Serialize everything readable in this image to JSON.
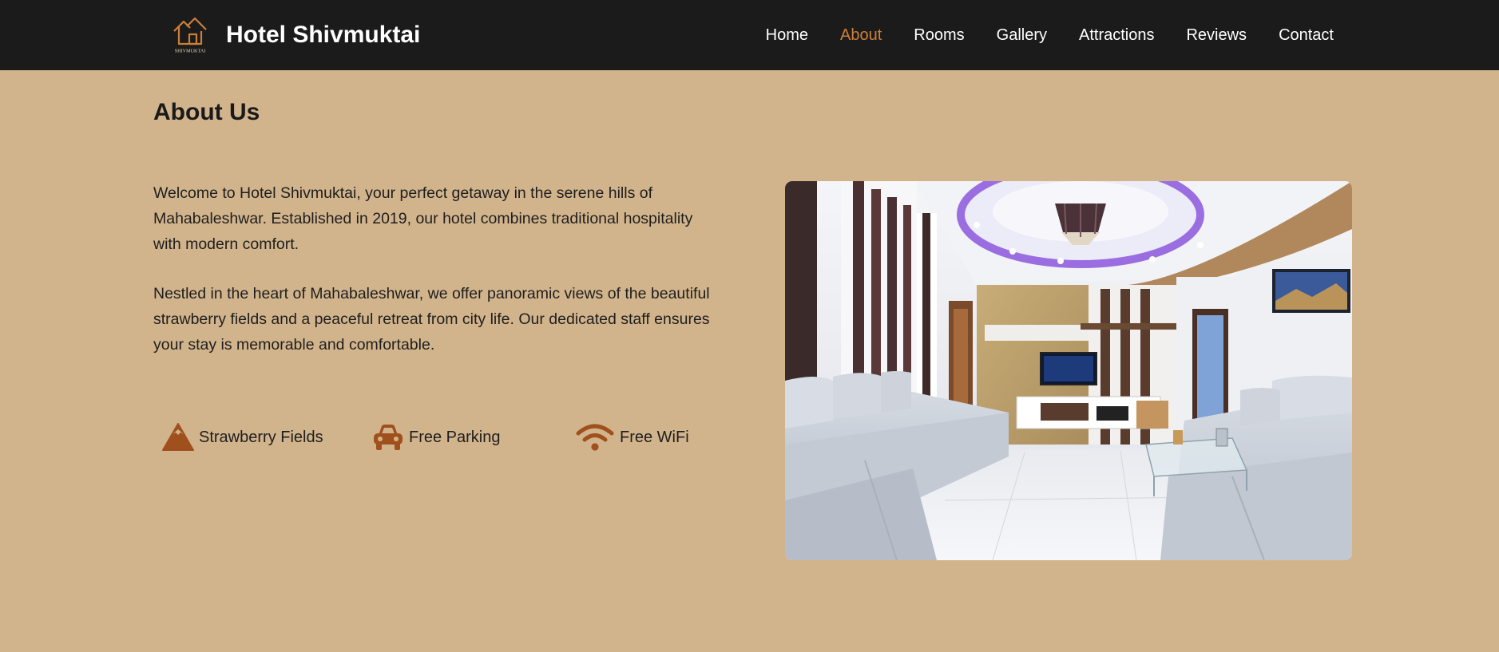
{
  "brand": {
    "name": "Hotel Shivmuktai",
    "logo_text": "SHIVMUKTAI",
    "logo_icon": "house-logo-icon"
  },
  "nav": {
    "items": [
      {
        "label": "Home",
        "active": false
      },
      {
        "label": "About",
        "active": true
      },
      {
        "label": "Rooms",
        "active": false
      },
      {
        "label": "Gallery",
        "active": false
      },
      {
        "label": "Attractions",
        "active": false
      },
      {
        "label": "Reviews",
        "active": false
      },
      {
        "label": "Contact",
        "active": false
      }
    ]
  },
  "about": {
    "title": "About Us",
    "paragraphs": [
      "Welcome to Hotel Shivmuktai, your perfect getaway in the serene hills of Mahabaleshwar. Established in 2019, our hotel combines traditional hospitality with modern comfort.",
      "Nestled in the heart of Mahabaleshwar, we offer panoramic views of the beautiful strawberry fields and a peaceful retreat from city life. Our dedicated staff ensures your stay is memorable and comfortable."
    ],
    "features": [
      {
        "label": "Strawberry Fields",
        "icon": "mountain-icon"
      },
      {
        "label": "Free Parking",
        "icon": "car-icon"
      },
      {
        "label": "Free WiFi",
        "icon": "wifi-icon"
      }
    ]
  },
  "colors": {
    "background": "#d2b48c",
    "navbar": "#1b1b1b",
    "accent": "#cd7f3a",
    "icon": "#a0501c"
  }
}
